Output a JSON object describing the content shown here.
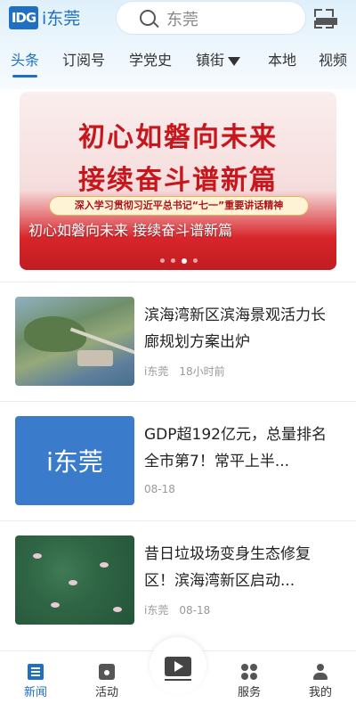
{
  "header": {
    "logo_mark": "IDG",
    "logo_text": "i东莞",
    "search_placeholder": "东莞"
  },
  "tabs": [
    {
      "label": "头条",
      "active": true
    },
    {
      "label": "订阅号",
      "active": false
    },
    {
      "label": "学党史",
      "active": false
    },
    {
      "label": "镇街",
      "active": false,
      "has_dropdown": true
    },
    {
      "label": "本地",
      "active": false
    },
    {
      "label": "视频",
      "active": false
    }
  ],
  "banner": {
    "headline_1": "初心如磐向未来",
    "headline_2": "接续奋斗谱新篇",
    "subline": "深入学习贯彻习近平总书记“七一”重要讲话精神",
    "caption": "初心如磐向未来 接续奋斗谱新篇",
    "slide_count": 4,
    "active_slide": 3
  },
  "news": [
    {
      "title": "滨海湾新区滨海景观活力长廊规划方案出炉",
      "source": "i东莞",
      "time": "18小时前"
    },
    {
      "title": "GDP超192亿元，总量排名全市第7！常平上半...",
      "source": "",
      "time": "08-18",
      "thumb_text": "i东莞"
    },
    {
      "title": "昔日垃圾场变身生态修复区！滨海湾新区启动...",
      "source": "i东莞",
      "time": "08-18"
    }
  ],
  "bottom_nav": [
    {
      "label": "新闻",
      "icon": "news-icon",
      "active": true
    },
    {
      "label": "活动",
      "icon": "calendar-icon",
      "active": false
    },
    {
      "label": "",
      "icon": "video-play-icon",
      "active": false
    },
    {
      "label": "服务",
      "icon": "grid-icon",
      "active": false
    },
    {
      "label": "我的",
      "icon": "user-icon",
      "active": false
    }
  ],
  "colors": {
    "accent": "#1f6fc2",
    "banner_red": "#c8161d"
  }
}
